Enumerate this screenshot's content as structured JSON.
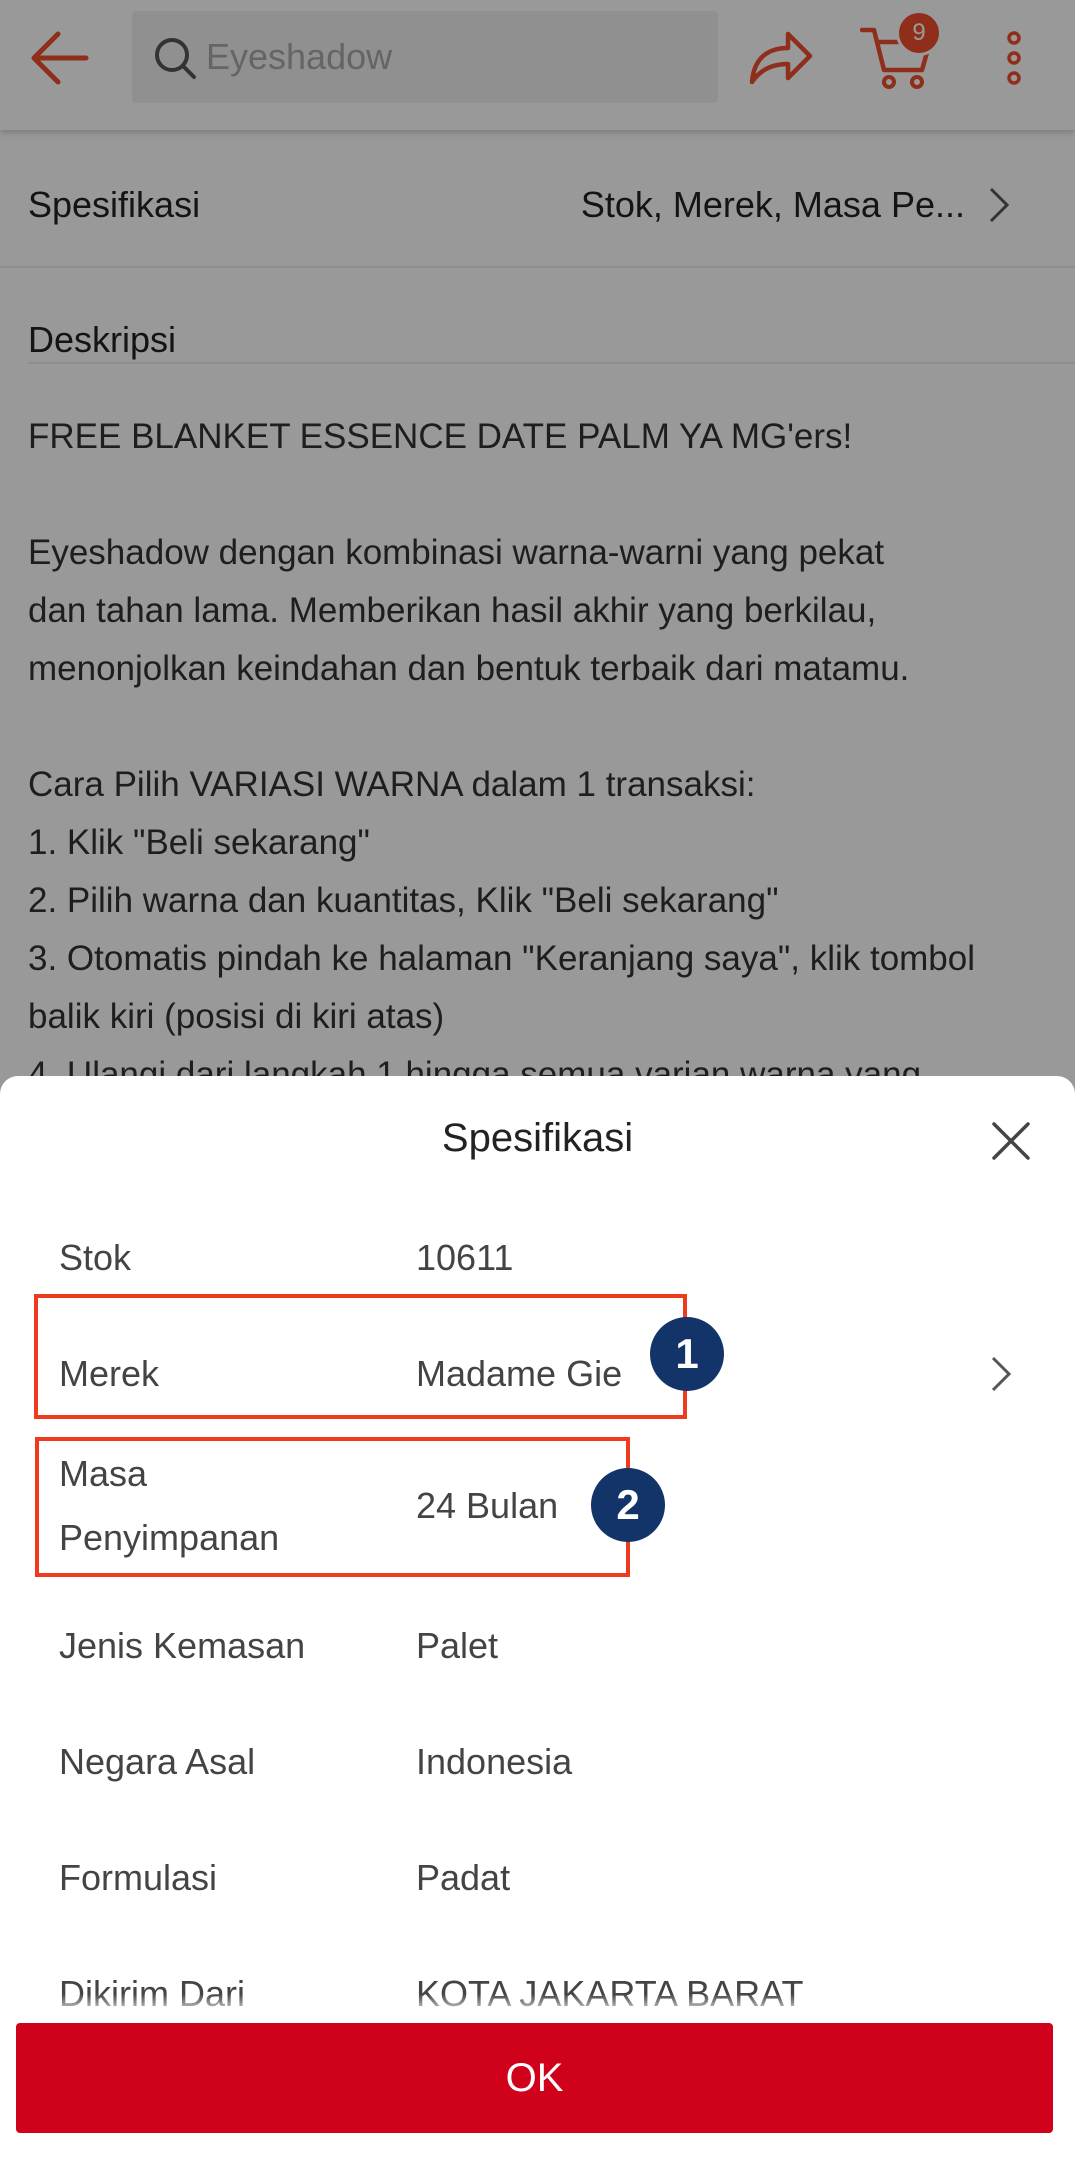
{
  "colors": {
    "accent": "#ee4d2d",
    "ok_button": "#d0011b",
    "highlight": "#ee3b1f",
    "badge": "#123468"
  },
  "header": {
    "search_placeholder": "Eyeshadow",
    "cart_count": "9",
    "icons": [
      "arrow-left-icon",
      "search-icon",
      "share-icon",
      "cart-icon",
      "more-vertical-icon"
    ]
  },
  "spec_row": {
    "label": "Spesifikasi",
    "summary": "Stok, Merek, Masa Pe..."
  },
  "description": {
    "title": "Deskripsi",
    "body": "FREE BLANKET ESSENCE DATE PALM YA MG'ers!\n\nEyeshadow dengan kombinasi warna-warni yang pekat\ndan tahan lama. Memberikan hasil akhir yang berkilau,\nmenonjolkan keindahan dan bentuk terbaik dari matamu.\n\nCara Pilih VARIASI WARNA dalam 1 transaksi:\n1. Klik \"Beli sekarang\"\n2. Pilih warna dan kuantitas, Klik \"Beli sekarang\"\n3. Otomatis pindah ke halaman \"Keranjang saya\", klik tombol\nbalik kiri (posisi di kiri atas)\n4. Ulangi dari langkah 1 hingga semua varian warna yang"
  },
  "sheet": {
    "title": "Spesifikasi",
    "items": [
      {
        "key": "Stok",
        "value": "10611"
      },
      {
        "key": "Merek",
        "value": "Madame Gie"
      },
      {
        "key": "Masa\nPenyimpanan",
        "value": "24 Bulan"
      },
      {
        "key": "Jenis Kemasan",
        "value": "Palet"
      },
      {
        "key": "Negara Asal",
        "value": "Indonesia"
      },
      {
        "key": "Formulasi",
        "value": "Padat"
      },
      {
        "key": "Dikirim Dari",
        "value": "KOTA JAKARTA BARAT"
      }
    ],
    "annotations": [
      "1",
      "2"
    ],
    "ok_label": "OK"
  }
}
